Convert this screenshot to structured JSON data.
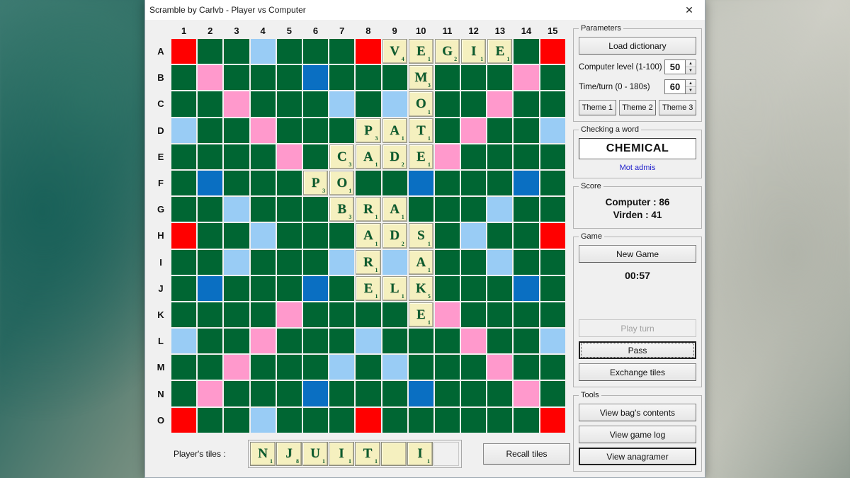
{
  "window": {
    "title": "Scramble by Carlvb - Player vs Computer",
    "close_icon": "close-icon"
  },
  "board": {
    "columns": [
      "1",
      "2",
      "3",
      "4",
      "5",
      "6",
      "7",
      "8",
      "9",
      "10",
      "11",
      "12",
      "13",
      "14",
      "15"
    ],
    "rows": [
      "A",
      "B",
      "C",
      "D",
      "E",
      "F",
      "G",
      "H",
      "I",
      "J",
      "K",
      "L",
      "M",
      "N",
      "O"
    ],
    "colors": {
      "triple_word": "#ff0000",
      "double_word": "#ff99cc",
      "triple_letter": "#0a6fc2",
      "double_letter": "#99ccf5",
      "normal": "#006633",
      "tile_bg": "#f5f0bf",
      "tile_text": "#0c5c2e"
    },
    "premium": [
      [
        "TW",
        "N",
        "N",
        "DL",
        "N",
        "N",
        "N",
        "TW",
        "N",
        "N",
        "N",
        "N",
        "N",
        "N",
        "TW"
      ],
      [
        "N",
        "DW",
        "N",
        "N",
        "N",
        "TL",
        "N",
        "N",
        "N",
        "N",
        "N",
        "N",
        "N",
        "DW",
        "N"
      ],
      [
        "N",
        "N",
        "DW",
        "N",
        "N",
        "N",
        "DL",
        "N",
        "DL",
        "N",
        "N",
        "N",
        "DW",
        "N",
        "N"
      ],
      [
        "DL",
        "N",
        "N",
        "DW",
        "N",
        "N",
        "N",
        "N",
        "N",
        "N",
        "N",
        "DW",
        "N",
        "N",
        "DL"
      ],
      [
        "N",
        "N",
        "N",
        "N",
        "DW",
        "N",
        "N",
        "N",
        "N",
        "N",
        "DW",
        "N",
        "N",
        "N",
        "N"
      ],
      [
        "N",
        "TL",
        "N",
        "N",
        "N",
        "N",
        "N",
        "N",
        "N",
        "TL",
        "N",
        "N",
        "N",
        "TL",
        "N"
      ],
      [
        "N",
        "N",
        "DL",
        "N",
        "N",
        "N",
        "N",
        "N",
        "N",
        "N",
        "N",
        "N",
        "DL",
        "N",
        "N"
      ],
      [
        "TW",
        "N",
        "N",
        "DL",
        "N",
        "N",
        "N",
        "N",
        "N",
        "N",
        "N",
        "DL",
        "N",
        "N",
        "TW"
      ],
      [
        "N",
        "N",
        "DL",
        "N",
        "N",
        "N",
        "DL",
        "N",
        "DL",
        "N",
        "N",
        "N",
        "DL",
        "N",
        "N"
      ],
      [
        "N",
        "TL",
        "N",
        "N",
        "N",
        "TL",
        "N",
        "N",
        "N",
        "TL",
        "N",
        "N",
        "N",
        "TL",
        "N"
      ],
      [
        "N",
        "N",
        "N",
        "N",
        "DW",
        "N",
        "N",
        "N",
        "N",
        "N",
        "DW",
        "N",
        "N",
        "N",
        "N"
      ],
      [
        "DL",
        "N",
        "N",
        "DW",
        "N",
        "N",
        "N",
        "DL",
        "N",
        "N",
        "N",
        "DW",
        "N",
        "N",
        "DL"
      ],
      [
        "N",
        "N",
        "DW",
        "N",
        "N",
        "N",
        "DL",
        "N",
        "DL",
        "N",
        "N",
        "N",
        "DW",
        "N",
        "N"
      ],
      [
        "N",
        "DW",
        "N",
        "N",
        "N",
        "TL",
        "N",
        "N",
        "N",
        "TL",
        "N",
        "N",
        "N",
        "DW",
        "N"
      ],
      [
        "TW",
        "N",
        "N",
        "DL",
        "N",
        "N",
        "N",
        "TW",
        "N",
        "N",
        "N",
        "N",
        "N",
        "N",
        "TW"
      ]
    ],
    "tiles": [
      {
        "row": 0,
        "col": 8,
        "letter": "V",
        "value": "4"
      },
      {
        "row": 0,
        "col": 9,
        "letter": "E",
        "value": "1"
      },
      {
        "row": 0,
        "col": 10,
        "letter": "G",
        "value": "2"
      },
      {
        "row": 0,
        "col": 11,
        "letter": "I",
        "value": "1"
      },
      {
        "row": 0,
        "col": 12,
        "letter": "E",
        "value": "1"
      },
      {
        "row": 1,
        "col": 9,
        "letter": "M",
        "value": "3"
      },
      {
        "row": 2,
        "col": 9,
        "letter": "O",
        "value": "1"
      },
      {
        "row": 3,
        "col": 7,
        "letter": "P",
        "value": "3"
      },
      {
        "row": 3,
        "col": 8,
        "letter": "A",
        "value": "1"
      },
      {
        "row": 3,
        "col": 9,
        "letter": "T",
        "value": "1"
      },
      {
        "row": 4,
        "col": 6,
        "letter": "C",
        "value": "3"
      },
      {
        "row": 4,
        "col": 7,
        "letter": "A",
        "value": "1"
      },
      {
        "row": 4,
        "col": 8,
        "letter": "D",
        "value": "2"
      },
      {
        "row": 4,
        "col": 9,
        "letter": "E",
        "value": "1"
      },
      {
        "row": 5,
        "col": 5,
        "letter": "P",
        "value": "3"
      },
      {
        "row": 5,
        "col": 6,
        "letter": "O",
        "value": "1"
      },
      {
        "row": 6,
        "col": 6,
        "letter": "B",
        "value": "3"
      },
      {
        "row": 6,
        "col": 7,
        "letter": "R",
        "value": "1"
      },
      {
        "row": 6,
        "col": 8,
        "letter": "A",
        "value": "1"
      },
      {
        "row": 7,
        "col": 7,
        "letter": "A",
        "value": "1"
      },
      {
        "row": 7,
        "col": 8,
        "letter": "D",
        "value": "2"
      },
      {
        "row": 7,
        "col": 9,
        "letter": "S",
        "value": "1"
      },
      {
        "row": 8,
        "col": 7,
        "letter": "R",
        "value": "1"
      },
      {
        "row": 8,
        "col": 9,
        "letter": "A",
        "value": "1"
      },
      {
        "row": 9,
        "col": 7,
        "letter": "E",
        "value": "1"
      },
      {
        "row": 9,
        "col": 8,
        "letter": "L",
        "value": "1"
      },
      {
        "row": 9,
        "col": 9,
        "letter": "K",
        "value": "5"
      },
      {
        "row": 10,
        "col": 9,
        "letter": "E",
        "value": "1"
      }
    ]
  },
  "rack": {
    "label": "Player's tiles :",
    "tiles": [
      {
        "letter": "N",
        "value": "1"
      },
      {
        "letter": "J",
        "value": "8"
      },
      {
        "letter": "U",
        "value": "1"
      },
      {
        "letter": "I",
        "value": "1"
      },
      {
        "letter": "T",
        "value": "1"
      },
      {
        "letter": "",
        "value": ""
      },
      {
        "letter": "I",
        "value": "1"
      }
    ],
    "recall_label": "Recall tiles"
  },
  "parameters": {
    "legend": "Parameters",
    "load_dictionary_label": "Load dictionary",
    "computer_level_label": "Computer level (1-100)",
    "computer_level_value": "50",
    "time_per_turn_label": "Time/turn (0 - 180s)",
    "time_per_turn_value": "60",
    "theme1_label": "Theme 1",
    "theme2_label": "Theme 2",
    "theme3_label": "Theme 3"
  },
  "checking": {
    "legend": "Checking a word",
    "word": "CHEMICAL",
    "status": "Mot admis",
    "status_color": "#2222cc"
  },
  "score": {
    "legend": "Score",
    "computer_line": "Computer :  86",
    "player_line": "Virden :  41",
    "computer_name": "Computer",
    "computer_value": "86",
    "player_name": "Virden",
    "player_value": "41"
  },
  "game": {
    "legend": "Game",
    "new_game_label": "New Game",
    "timer": "00:57",
    "play_turn_label": "Play turn",
    "pass_label": "Pass",
    "exchange_label": "Exchange tiles"
  },
  "tools": {
    "legend": "Tools",
    "view_bag_label": "View bag's contents",
    "view_log_label": "View game log",
    "view_anagramer_label": "View anagramer"
  }
}
